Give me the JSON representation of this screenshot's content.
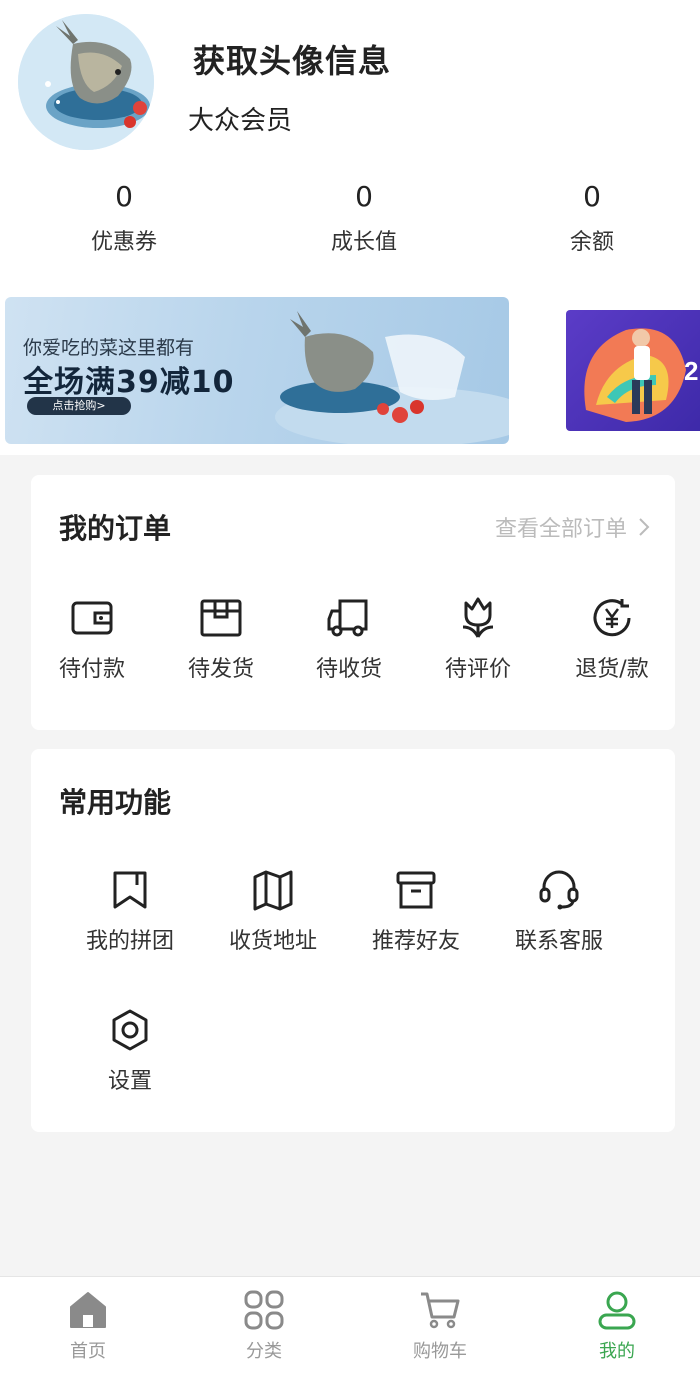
{
  "profile": {
    "nickname": "获取头像信息",
    "level": "大众会员"
  },
  "stats": [
    {
      "value": "0",
      "label": "优惠券"
    },
    {
      "value": "0",
      "label": "成长值"
    },
    {
      "value": "0",
      "label": "余额"
    }
  ],
  "banner": {
    "subtitle": "你爱吃的菜这里都有",
    "headline": "全场满39减10",
    "button": "点击抢购>"
  },
  "orders": {
    "title": "我的订单",
    "view_all": "查看全部订单",
    "items": [
      {
        "label": "待付款",
        "icon": "wallet-icon"
      },
      {
        "label": "待发货",
        "icon": "package-icon"
      },
      {
        "label": "待收货",
        "icon": "truck-icon"
      },
      {
        "label": "待评价",
        "icon": "tulip-icon"
      },
      {
        "label": "退货/款",
        "icon": "yuan-refund-icon"
      }
    ]
  },
  "functions": {
    "title": "常用功能",
    "items": [
      {
        "label": "我的拼团",
        "icon": "bookmark-icon"
      },
      {
        "label": "收货地址",
        "icon": "map-icon"
      },
      {
        "label": "推荐好友",
        "icon": "archive-box-icon"
      },
      {
        "label": "联系客服",
        "icon": "headset-icon"
      },
      {
        "label": "设置",
        "icon": "hexagon-settings-icon"
      }
    ]
  },
  "tabbar": {
    "tabs": [
      {
        "label": "首页",
        "icon": "home-icon"
      },
      {
        "label": "分类",
        "icon": "category-grid-icon"
      },
      {
        "label": "购物车",
        "icon": "cart-icon"
      },
      {
        "label": "我的",
        "icon": "user-icon"
      }
    ],
    "active_index": 3,
    "colors": {
      "active": "#3aa650",
      "inactive": "#999999"
    }
  }
}
